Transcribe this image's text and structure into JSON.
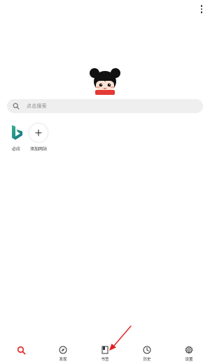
{
  "colors": {
    "accent": "#e53935",
    "arrow": "#e02020",
    "search_bg": "#efefef",
    "bing_teal": "#1a8f85",
    "icon_dark": "#333333"
  },
  "top_bar": {
    "more_icon": "more-vertical-icon"
  },
  "mascot": {
    "icon": "cartoon-girl-logo"
  },
  "search": {
    "placeholder": "点击搜索",
    "icon": "search-icon"
  },
  "shortcuts": [
    {
      "label": "必应",
      "icon": "bing-icon"
    },
    {
      "label": "添加网站",
      "icon": "plus-icon"
    }
  ],
  "bottom_nav": [
    {
      "label": "",
      "icon": "search-icon",
      "active": true
    },
    {
      "label": "发现",
      "icon": "compass-icon"
    },
    {
      "label": "书签",
      "icon": "bookmark-icon"
    },
    {
      "label": "历史",
      "icon": "clock-icon"
    },
    {
      "label": "设置",
      "icon": "gear-icon"
    }
  ]
}
